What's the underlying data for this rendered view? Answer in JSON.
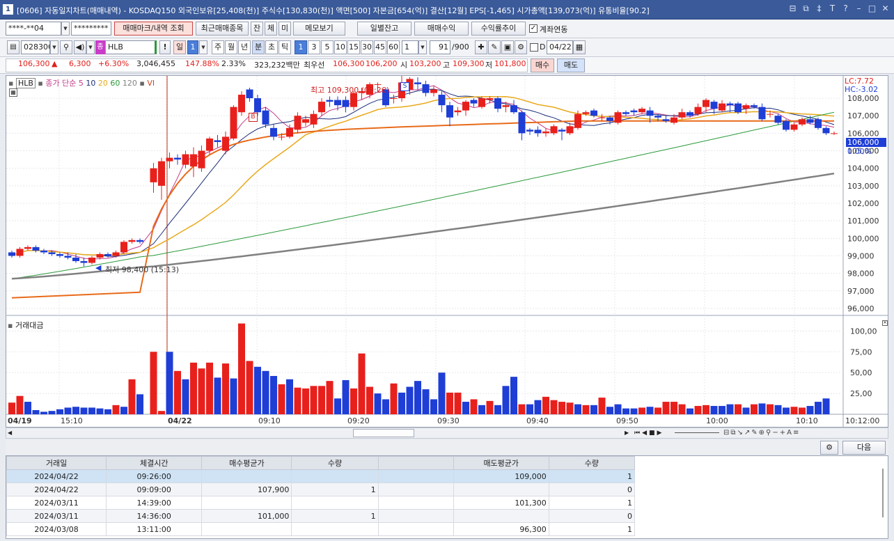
{
  "titlebar": {
    "num": "1",
    "title": "[0606] 자동일지차트(매매내역) - KOSDAQ150 외국인보유[25,408(천)] 주식수[130,830(천)] 액면[500] 자본금[654(억)] 결산[12월] EPS[-1,465] 시가총액[139,073(억)] 유통비율[90.2]"
  },
  "toolbar1": {
    "account": "****-**04",
    "password": "*********",
    "mark_btn": "매매마크/내역 조회",
    "recent_btn": "최근매매종목",
    "jan": "잔",
    "che": "체",
    "mi": "미",
    "memo_btn": "메모보기",
    "daily_btn": "일별잔고",
    "profit_btn": "매매수익",
    "rate_btn": "수익률추이",
    "link_label": "계좌연동"
  },
  "toolbar2": {
    "code": "028300",
    "name": "HLB",
    "jong": "종",
    "bang": "!",
    "il": "일",
    "il_num": "1",
    "periods": [
      "주",
      "월",
      "년",
      "분",
      "초",
      "틱"
    ],
    "minutes": [
      "1",
      "3",
      "5",
      "10",
      "15",
      "30",
      "45",
      "60"
    ],
    "count": "1",
    "show": "91",
    "total": "/900",
    "d_label": "D",
    "date": "04/22"
  },
  "quote": {
    "price": "106,300",
    "arrow": "▲",
    "change": "6,300",
    "pct": "+6.30%",
    "volume": "3,046,455",
    "vol_pct": "147.88%",
    "turnover": "2.33%",
    "amount": "323,232백만",
    "pref_label": "최우선",
    "pref_sell": "106,300",
    "pref_buy": "106,200",
    "open_label": "시",
    "open": "103,200",
    "high_label": "고",
    "high": "109,300",
    "low_label": "저",
    "low": "101,800",
    "buy_btn": "매수",
    "sell_btn": "매도"
  },
  "chart_header": {
    "name": "HLB",
    "ma_label": "종가 단순",
    "ma_periods": [
      "5",
      "10",
      "20",
      "60",
      "120"
    ],
    "vi": "VI",
    "lc": "LC:7.72",
    "hc": "HC:-3.02",
    "cur_price": "106,000",
    "cur_pct": "0.00%",
    "high_ann": "최고 109,300 (09:26)",
    "low_ann": "최저 98,400 (15:13)",
    "marker_s": "S",
    "marker_b": "B"
  },
  "vol_header": {
    "title": "거래대금"
  },
  "colors": {
    "up": "#e8201c",
    "down": "#1e3ed6",
    "ma5": "#c23b8a",
    "ma10": "#1a2b7a",
    "ma20": "#e9a91b",
    "ma60": "#2a9a3a",
    "ma120": "#808080",
    "vwap": "#e86a1a",
    "vi": "#c03010"
  },
  "chart_data": {
    "type": "candlestick",
    "y_ticks": [
      "108,000",
      "107,000",
      "106,000",
      "105,000",
      "104,000",
      "103,000",
      "102,000",
      "101,000",
      "100,000",
      "99,000",
      "98,000",
      "97,000",
      "96,000"
    ],
    "vol_ticks": [
      "100,00",
      "75,00",
      "50,00",
      "25,00"
    ],
    "x_labels": [
      "04/19",
      "15:10",
      "04/22",
      "09:10",
      "09:20",
      "09:30",
      "09:40",
      "09:50",
      "10:00",
      "10:10",
      "10:12:00"
    ],
    "candles": [
      [
        99.2,
        99.0,
        99.3,
        98.9
      ],
      [
        99.0,
        99.4,
        99.5,
        98.9
      ],
      [
        99.4,
        99.5,
        99.6,
        99.3
      ],
      [
        99.5,
        99.3,
        99.6,
        99.2
      ],
      [
        99.3,
        99.2,
        99.4,
        99.1
      ],
      [
        99.2,
        99.1,
        99.3,
        99.0
      ],
      [
        99.1,
        99.0,
        99.2,
        98.9
      ],
      [
        99.0,
        98.9,
        99.2,
        98.8
      ],
      [
        98.9,
        98.7,
        99.1,
        98.6
      ],
      [
        98.7,
        98.6,
        98.9,
        98.4
      ],
      [
        98.6,
        98.9,
        99.0,
        98.5
      ],
      [
        98.9,
        99.1,
        99.2,
        98.8
      ],
      [
        99.1,
        99.0,
        99.2,
        98.9
      ],
      [
        99.0,
        99.2,
        99.3,
        98.9
      ],
      [
        99.2,
        99.8,
        99.9,
        99.1
      ],
      [
        99.8,
        99.9,
        100.0,
        99.7
      ],
      [
        99.9,
        99.8,
        100.0,
        99.7
      ],
      [
        103.2,
        104.0,
        104.3,
        102.6
      ],
      [
        103.0,
        104.4,
        104.6,
        102.2
      ],
      [
        104.4,
        104.6,
        104.9,
        104.0
      ],
      [
        104.6,
        104.5,
        104.8,
        104.2
      ],
      [
        104.2,
        104.8,
        105.0,
        104.0
      ],
      [
        104.1,
        104.8,
        105.2,
        103.5
      ],
      [
        104.0,
        105.0,
        105.3,
        103.8
      ],
      [
        105.0,
        105.7,
        105.8,
        104.8
      ],
      [
        105.6,
        105.5,
        105.9,
        105.2
      ],
      [
        105.0,
        105.8,
        106.1,
        104.8
      ],
      [
        105.7,
        107.5,
        107.6,
        105.6
      ],
      [
        107.2,
        108.2,
        108.4,
        107.0
      ],
      [
        108.5,
        108.0,
        108.6,
        107.8
      ],
      [
        108.0,
        107.2,
        108.2,
        107.0
      ],
      [
        107.3,
        106.5,
        107.5,
        106.3
      ],
      [
        106.3,
        105.8,
        106.5,
        105.6
      ],
      [
        105.8,
        105.8,
        106.0,
        105.6
      ],
      [
        105.8,
        106.3,
        106.5,
        105.7
      ],
      [
        106.2,
        107.0,
        107.2,
        106.0
      ],
      [
        106.6,
        106.8,
        107.0,
        106.4
      ],
      [
        106.5,
        107.1,
        107.3,
        106.3
      ],
      [
        107.2,
        107.8,
        108.0,
        107.0
      ],
      [
        107.9,
        107.8,
        108.1,
        107.5
      ],
      [
        107.9,
        107.6,
        108.1,
        107.3
      ],
      [
        107.9,
        107.5,
        108.1,
        107.2
      ],
      [
        107.5,
        108.3,
        108.4,
        107.3
      ],
      [
        108.3,
        108.4,
        108.6,
        107.9
      ],
      [
        108.2,
        108.8,
        108.9,
        108.0
      ],
      [
        108.8,
        108.8,
        108.9,
        108.4
      ],
      [
        108.5,
        107.6,
        108.6,
        107.5
      ],
      [
        108.0,
        108.0,
        108.2,
        107.7
      ],
      [
        108.0,
        108.9,
        109.3,
        107.8
      ],
      [
        108.5,
        109.1,
        109.2,
        108.2
      ],
      [
        108.9,
        108.8,
        109.2,
        108.5
      ],
      [
        108.8,
        108.3,
        109.0,
        108.1
      ],
      [
        108.3,
        108.5,
        108.7,
        108.1
      ],
      [
        108.2,
        107.6,
        108.4,
        107.2
      ],
      [
        107.6,
        106.9,
        107.8,
        106.4
      ],
      [
        107.2,
        107.3,
        107.5,
        107.0
      ],
      [
        107.3,
        107.8,
        107.9,
        107.0
      ],
      [
        107.9,
        107.7,
        108.0,
        107.5
      ],
      [
        107.5,
        108.0,
        108.1,
        107.4
      ],
      [
        107.9,
        108.0,
        108.1,
        107.7
      ],
      [
        108.0,
        107.4,
        108.1,
        107.2
      ],
      [
        107.5,
        107.6,
        107.8,
        107.2
      ],
      [
        107.6,
        107.2,
        107.9,
        107.1
      ],
      [
        107.2,
        106.0,
        107.3,
        105.6
      ],
      [
        106.2,
        106.1,
        106.3,
        105.9
      ],
      [
        106.2,
        106.0,
        106.4,
        105.8
      ],
      [
        106.0,
        106.1,
        106.3,
        105.8
      ],
      [
        106.0,
        106.4,
        106.5,
        105.9
      ],
      [
        106.2,
        106.1,
        106.3,
        105.6
      ],
      [
        106.0,
        106.4,
        106.6,
        105.9
      ],
      [
        106.3,
        107.1,
        107.3,
        106.2
      ],
      [
        107.1,
        107.2,
        107.3,
        107.0
      ],
      [
        107.3,
        107.0,
        107.4,
        106.9
      ],
      [
        106.9,
        106.9,
        107.1,
        106.7
      ],
      [
        106.9,
        106.7,
        107.0,
        106.5
      ],
      [
        106.6,
        107.2,
        107.3,
        106.5
      ],
      [
        107.2,
        107.1,
        107.3,
        107.0
      ],
      [
        107.3,
        107.2,
        107.4,
        107.0
      ],
      [
        107.2,
        107.4,
        107.5,
        107.1
      ],
      [
        107.3,
        107.0,
        107.5,
        106.6
      ],
      [
        107.0,
        106.9,
        107.1,
        106.7
      ],
      [
        106.8,
        106.7,
        107.0,
        106.6
      ],
      [
        106.6,
        106.9,
        107.1,
        106.5
      ],
      [
        106.9,
        107.2,
        107.4,
        106.8
      ],
      [
        107.2,
        107.0,
        107.3,
        106.9
      ],
      [
        107.1,
        107.5,
        107.7,
        107.0
      ],
      [
        107.5,
        107.9,
        108.0,
        107.2
      ],
      [
        107.8,
        107.4,
        107.9,
        107.1
      ],
      [
        107.3,
        107.7,
        107.9,
        107.2
      ],
      [
        107.7,
        107.6,
        107.8,
        107.2
      ],
      [
        107.7,
        107.2,
        107.8,
        107.1
      ],
      [
        107.4,
        107.6,
        107.7,
        107.1
      ],
      [
        107.6,
        107.5,
        107.7,
        107.4
      ],
      [
        107.5,
        106.8,
        107.7,
        106.7
      ],
      [
        107.1,
        107.1,
        107.3,
        106.9
      ],
      [
        107.0,
        106.6,
        107.1,
        106.5
      ],
      [
        106.7,
        106.2,
        106.8,
        106.1
      ],
      [
        106.2,
        106.5,
        106.6,
        106.1
      ],
      [
        106.5,
        106.8,
        106.9,
        106.4
      ],
      [
        106.8,
        106.6,
        107.0,
        106.5
      ],
      [
        106.8,
        106.3,
        106.9,
        106.2
      ],
      [
        106.3,
        106.0,
        106.4,
        105.9
      ],
      [
        106.0,
        106.0,
        106.1,
        105.9
      ]
    ],
    "volume": [
      [
        14,
        "u"
      ],
      [
        22,
        "u"
      ],
      [
        15,
        "d"
      ],
      [
        5,
        "d"
      ],
      [
        3,
        "d"
      ],
      [
        4,
        "d"
      ],
      [
        6,
        "d"
      ],
      [
        8,
        "d"
      ],
      [
        9,
        "d"
      ],
      [
        8,
        "d"
      ],
      [
        8,
        "d"
      ],
      [
        7,
        "d"
      ],
      [
        6,
        "d"
      ],
      [
        11,
        "u"
      ],
      [
        9,
        "d"
      ],
      [
        42,
        "u"
      ],
      [
        24,
        "d"
      ],
      [
        75,
        "u"
      ],
      [
        4,
        "u"
      ],
      [
        75,
        "d"
      ],
      [
        52,
        "u"
      ],
      [
        42,
        "d"
      ],
      [
        62,
        "u"
      ],
      [
        55,
        "u"
      ],
      [
        62,
        "u"
      ],
      [
        44,
        "d"
      ],
      [
        61,
        "u"
      ],
      [
        43,
        "d"
      ],
      [
        109,
        "u"
      ],
      [
        64,
        "u"
      ],
      [
        57,
        "d"
      ],
      [
        52,
        "d"
      ],
      [
        46,
        "d"
      ],
      [
        36,
        "u"
      ],
      [
        42,
        "d"
      ],
      [
        32,
        "u"
      ],
      [
        31,
        "u"
      ],
      [
        34,
        "u"
      ],
      [
        34,
        "u"
      ],
      [
        40,
        "u"
      ],
      [
        19,
        "d"
      ],
      [
        41,
        "d"
      ],
      [
        31,
        "u"
      ],
      [
        73,
        "u"
      ],
      [
        33,
        "u"
      ],
      [
        25,
        "d"
      ],
      [
        18,
        "d"
      ],
      [
        37,
        "u"
      ],
      [
        26,
        "d"
      ],
      [
        33,
        "d"
      ],
      [
        40,
        "d"
      ],
      [
        30,
        "d"
      ],
      [
        18,
        "d"
      ],
      [
        50,
        "d"
      ],
      [
        26,
        "u"
      ],
      [
        26,
        "u"
      ],
      [
        15,
        "d"
      ],
      [
        18,
        "u"
      ],
      [
        11,
        "d"
      ],
      [
        16,
        "u"
      ],
      [
        11,
        "d"
      ],
      [
        34,
        "d"
      ],
      [
        45,
        "d"
      ],
      [
        12,
        "u"
      ],
      [
        12,
        "d"
      ],
      [
        17,
        "d"
      ],
      [
        21,
        "u"
      ],
      [
        17,
        "u"
      ],
      [
        15,
        "u"
      ],
      [
        14,
        "u"
      ],
      [
        12,
        "d"
      ],
      [
        11,
        "u"
      ],
      [
        11,
        "d"
      ],
      [
        20,
        "u"
      ],
      [
        9,
        "d"
      ],
      [
        12,
        "d"
      ],
      [
        7,
        "d"
      ],
      [
        7,
        "d"
      ],
      [
        8,
        "u"
      ],
      [
        9,
        "d"
      ],
      [
        8,
        "u"
      ],
      [
        15,
        "u"
      ],
      [
        15,
        "u"
      ],
      [
        12,
        "u"
      ],
      [
        7,
        "d"
      ],
      [
        10,
        "u"
      ],
      [
        11,
        "u"
      ],
      [
        10,
        "d"
      ],
      [
        10,
        "d"
      ],
      [
        12,
        "d"
      ],
      [
        12,
        "u"
      ],
      [
        8,
        "d"
      ],
      [
        12,
        "u"
      ],
      [
        13,
        "d"
      ],
      [
        12,
        "u"
      ],
      [
        11,
        "d"
      ],
      [
        8,
        "d"
      ],
      [
        9,
        "u"
      ],
      [
        8,
        "u"
      ],
      [
        10,
        "d"
      ],
      [
        15,
        "d"
      ],
      [
        19,
        "d"
      ]
    ]
  },
  "table": {
    "headers": [
      "거래일",
      "체결시간",
      "매수평균가",
      "수량",
      "",
      "매도평균가",
      "수량"
    ],
    "rows": [
      [
        "2024/04/22",
        "09:26:00",
        "",
        "",
        "",
        "109,000",
        "1"
      ],
      [
        "2024/04/22",
        "09:09:00",
        "107,900",
        "1",
        "",
        "",
        "0"
      ],
      [
        "2024/03/11",
        "14:39:00",
        "",
        "",
        "",
        "101,300",
        "1"
      ],
      [
        "2024/03/11",
        "14:36:00",
        "101,000",
        "1",
        "",
        "",
        "0"
      ],
      [
        "2024/03/08",
        "13:11:00",
        "",
        "",
        "",
        "96,300",
        "1"
      ]
    ],
    "next_btn": "다음"
  }
}
